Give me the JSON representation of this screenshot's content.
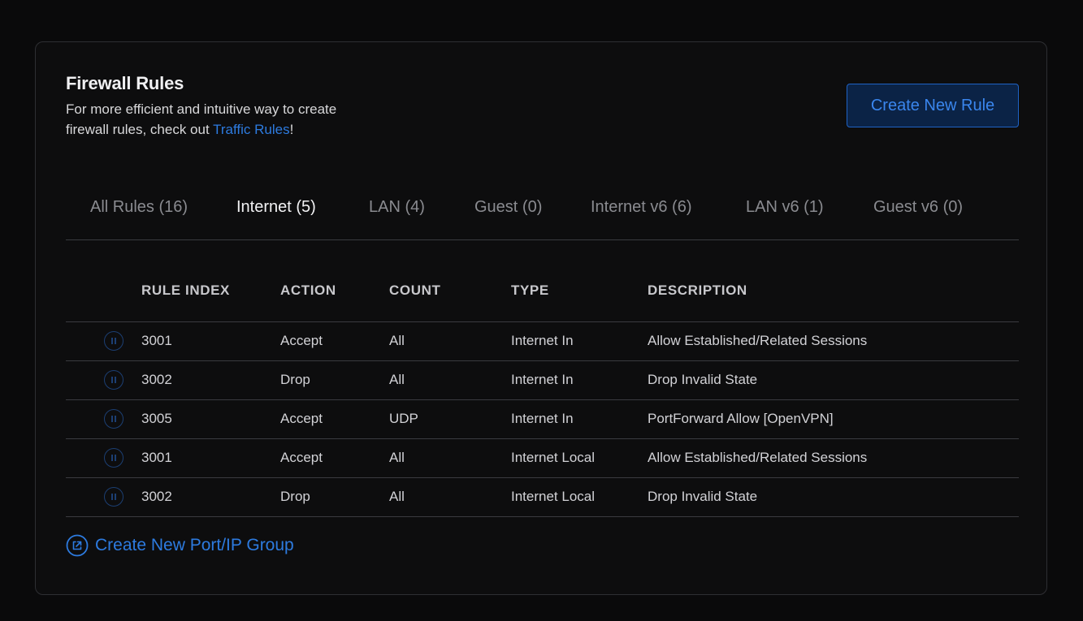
{
  "header": {
    "title": "Firewall Rules",
    "subtitle_text": "For more efficient and intuitive way to create firewall rules, check out ",
    "subtitle_link": "Traffic Rules",
    "subtitle_suffix": "!",
    "create_button": "Create New Rule"
  },
  "tabs": [
    {
      "label": "All Rules (16)",
      "active": false
    },
    {
      "label": "Internet (5)",
      "active": true
    },
    {
      "label": "LAN (4)",
      "active": false
    },
    {
      "label": "Guest (0)",
      "active": false
    },
    {
      "label": "Internet v6 (6)",
      "active": false
    },
    {
      "label": "LAN v6 (1)",
      "active": false
    },
    {
      "label": "Guest v6 (0)",
      "active": false
    }
  ],
  "table": {
    "columns": [
      "RULE INDEX",
      "ACTION",
      "COUNT",
      "TYPE",
      "DESCRIPTION"
    ],
    "rows": [
      {
        "index": "3001",
        "action": "Accept",
        "count": "All",
        "type": "Internet In",
        "description": "Allow Established/Related Sessions"
      },
      {
        "index": "3002",
        "action": "Drop",
        "count": "All",
        "type": "Internet In",
        "description": "Drop Invalid State"
      },
      {
        "index": "3005",
        "action": "Accept",
        "count": "UDP",
        "type": "Internet In",
        "description": "PortForward Allow [OpenVPN]"
      },
      {
        "index": "3001",
        "action": "Accept",
        "count": "All",
        "type": "Internet Local",
        "description": "Allow Established/Related Sessions"
      },
      {
        "index": "3002",
        "action": "Drop",
        "count": "All",
        "type": "Internet Local",
        "description": "Drop Invalid State"
      }
    ]
  },
  "footer": {
    "group_link": "Create New Port/IP Group",
    "icon": "external-link-icon"
  },
  "colors": {
    "accent": "#2d7be0",
    "background": "#0a0a0b",
    "panel_border": "#2e2f33"
  }
}
